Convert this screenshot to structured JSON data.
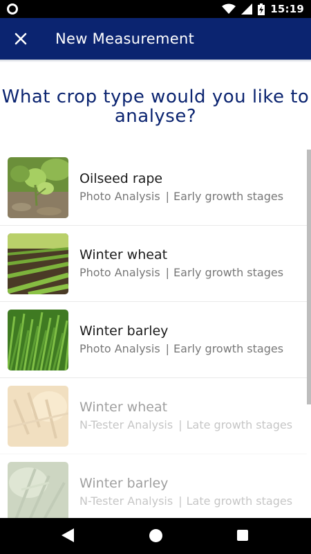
{
  "status_bar": {
    "time": "15:19",
    "icons": [
      "circle-notification-icon",
      "wifi-icon",
      "signal-icon",
      "battery-charging-icon"
    ]
  },
  "app_bar": {
    "close_icon": "close-icon",
    "title": "New Measurement",
    "background": "#0b2470"
  },
  "question": "What crop type would you like to analyse?",
  "crops": [
    {
      "title": "Oilseed rape",
      "analysis": "Photo Analysis",
      "stage": "Early growth stages",
      "enabled": true,
      "thumb": "oilseed-rape-photo"
    },
    {
      "title": "Winter wheat",
      "analysis": "Photo Analysis",
      "stage": "Early growth stages",
      "enabled": true,
      "thumb": "winter-wheat-rows-photo"
    },
    {
      "title": "Winter barley",
      "analysis": "Photo Analysis",
      "stage": "Early growth stages",
      "enabled": true,
      "thumb": "winter-barley-grass-photo"
    },
    {
      "title": "Winter wheat",
      "analysis": "N-Tester Analysis",
      "stage": "Late growth stages",
      "enabled": false,
      "thumb": "wheat-ears-photo"
    },
    {
      "title": "Winter barley",
      "analysis": "N-Tester Analysis",
      "stage": "Late growth stages",
      "enabled": false,
      "thumb": "barley-ears-photo"
    }
  ],
  "separator": "|",
  "nav_bar": {
    "icons": [
      "back-icon",
      "home-icon",
      "recents-icon"
    ]
  },
  "colors": {
    "primary": "#0b2470",
    "title_text": "#1a1a1a",
    "subtitle_text": "#777777"
  }
}
